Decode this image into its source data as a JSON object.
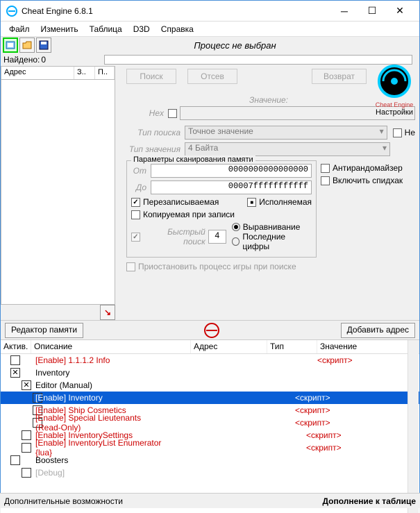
{
  "window": {
    "title": "Cheat Engine 6.8.1"
  },
  "menu": {
    "file": "Файл",
    "edit": "Изменить",
    "table": "Таблица",
    "d3d": "D3D",
    "help": "Справка"
  },
  "toolbar": {
    "process_text": "Процесс не выбран"
  },
  "found": {
    "label": "Найдено:",
    "count": "0"
  },
  "list_head": {
    "address": "Адрес",
    "value": "З..",
    "prev": "П.."
  },
  "buttons": {
    "memory_view": "Редактор памяти",
    "search": "Поиск",
    "filter": "Отсев",
    "undo": "Возврат",
    "add_address": "Добавить адрес"
  },
  "logo": {
    "caption": "Cheat Engine",
    "settings": "Настройки"
  },
  "scan": {
    "value_label": "Значение:",
    "hex_label": "Hex",
    "scan_type_label": "Тип поиска",
    "scan_type_value": "Точное значение",
    "not_label": "Не",
    "value_type_label": "Тип значения",
    "value_type_value": "4 Байта",
    "params_title": "Параметры сканирования памяти",
    "from_label": "От",
    "from_value": "0000000000000000",
    "to_label": "До",
    "to_value": "00007fffffffffff",
    "writable": "Перезаписываемая",
    "executable": "Исполняемая",
    "cow": "Копируемая при записи",
    "fast": "Быстрый поиск",
    "fast_val": "4",
    "alignment": "Выравнивание",
    "last_digits": "Последние цифры",
    "antirand": "Антирандомайзер",
    "speedhack": "Включить спидхак",
    "pause": "Приостановить процесс игры при поиске"
  },
  "table": {
    "headers": {
      "active": "Актив.",
      "desc": "Описание",
      "addr": "Адрес",
      "type": "Тип",
      "value": "Значение"
    },
    "rows": [
      {
        "indent": 0,
        "checked": false,
        "desc": "[Enable] 1.1.1.2 Info",
        "value": "<скрипт>",
        "cls": "red"
      },
      {
        "indent": 0,
        "checked": true,
        "desc": "Inventory",
        "value": "",
        "cls": ""
      },
      {
        "indent": 1,
        "checked": true,
        "desc": "Editor (Manual)",
        "value": "",
        "cls": ""
      },
      {
        "indent": 2,
        "checked": false,
        "desc": "[Enable] Inventory",
        "value": "<скрипт>",
        "cls": "red",
        "selected": true
      },
      {
        "indent": 2,
        "checked": false,
        "desc": "[Enable] Ship Cosmetics",
        "value": "<скрипт>",
        "cls": "red"
      },
      {
        "indent": 2,
        "checked": false,
        "desc": "[Enable] Special Lieutenants (Read-Only)",
        "value": "<скрипт>",
        "cls": "red"
      },
      {
        "indent": 1,
        "checked": false,
        "desc": "[Enable] InventorySettings",
        "value": "<скрипт>",
        "cls": "red"
      },
      {
        "indent": 1,
        "checked": false,
        "desc": "[Enable] InventoryList Enumerator {lua}",
        "value": "<скрипт>",
        "cls": "red"
      },
      {
        "indent": 0,
        "checked": false,
        "desc": "Boosters",
        "value": "",
        "cls": ""
      },
      {
        "indent": 1,
        "checked": false,
        "desc": "[Debug]",
        "value": "",
        "cls": "gray"
      }
    ]
  },
  "footer": {
    "left": "Дополнительные возможности",
    "right": "Дополнение к таблице"
  }
}
